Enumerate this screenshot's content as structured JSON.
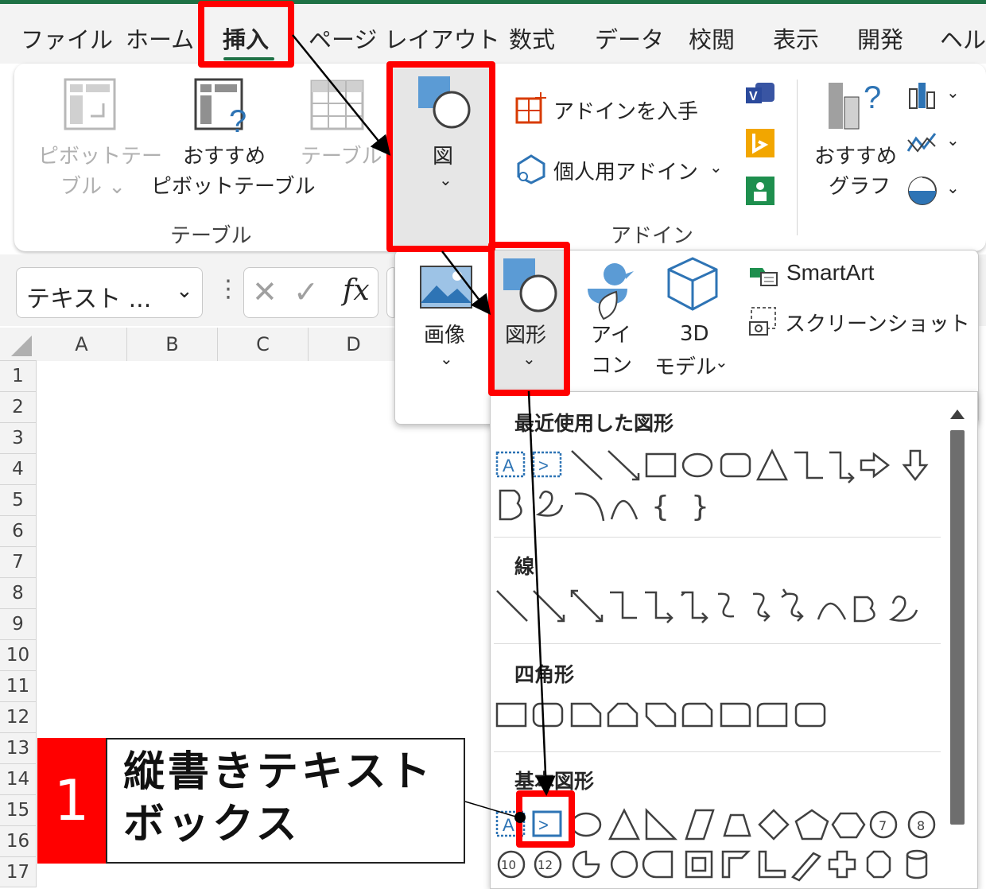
{
  "tabs": [
    "ファイル",
    "ホーム",
    "挿入",
    "ページ レイアウト",
    "数式",
    "データ",
    "校閲",
    "表示",
    "開発",
    "ヘルプ"
  ],
  "ribbon": {
    "pivot_label_1": "ピボットテー",
    "pivot_label_2": "ブル ⌄",
    "rec_pivot_label_1": "おすすめ",
    "rec_pivot_label_2": "ピボットテーブル",
    "table_label": "テーブル",
    "group_table": "テーブル",
    "figure_label": "図",
    "get_addins": "アドインを入手",
    "personal_addins": "個人用アドイン",
    "group_addins": "アドイン",
    "rec_chart_1": "おすすめ",
    "rec_chart_2": "グラフ"
  },
  "formula_bar": {
    "name_box": "テキスト ...",
    "fx": "fx"
  },
  "grid": {
    "columns": [
      "A",
      "B",
      "C",
      "D"
    ],
    "rows": [
      "1",
      "2",
      "3",
      "4",
      "5",
      "6",
      "7",
      "8",
      "9",
      "10",
      "11",
      "12",
      "13",
      "14",
      "15",
      "16",
      "17"
    ]
  },
  "figure_menu": {
    "image": "画像",
    "shapes": "図形",
    "icon_1": "アイ",
    "icon_2": "コン",
    "model_1": "3D",
    "model_2": "モデル",
    "smartart": "SmartArt",
    "screenshot": "スクリーンショット"
  },
  "shapes_menu": {
    "recent": "最近使用した図形",
    "lines": "線",
    "rectangles": "四角形",
    "basic": "基本図形",
    "num_10": "10",
    "num_12": "12",
    "num_7": "7",
    "num_8": "8"
  },
  "callout": {
    "number": "1",
    "line1": "縦書きテキスト",
    "line2": "ボックス"
  },
  "colors": {
    "excel_green": "#1e7145",
    "highlight_red": "#ff0000",
    "shape_blue": "#2e74b5"
  }
}
